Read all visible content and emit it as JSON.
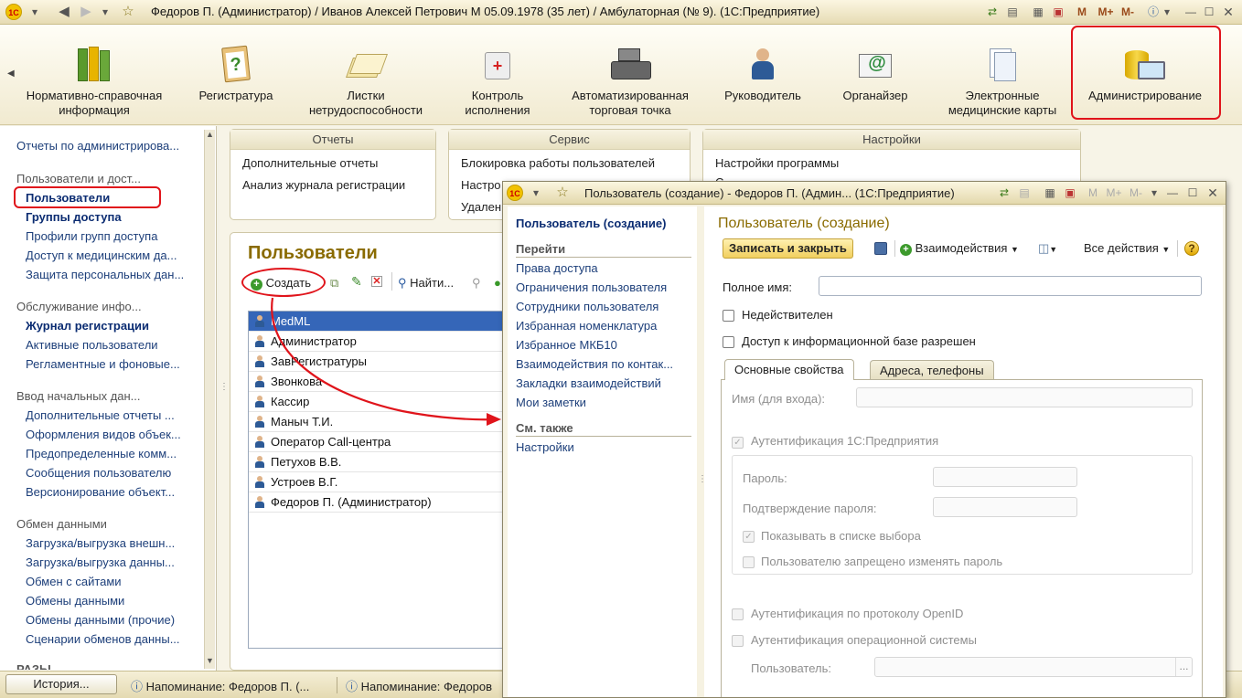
{
  "window": {
    "title": "Федоров П. (Администратор) / Иванов Алексей Петрович М 05.09.1978 (35 лет) / Амбулаторная (№ 9).  (1С:Предприятие)",
    "logo": "1С",
    "m_buttons": [
      "M",
      "M+",
      "M-"
    ]
  },
  "sections": [
    {
      "label": "Нормативно-справочная информация",
      "icon": "binders-icon"
    },
    {
      "label": "Регистратура",
      "icon": "clipboard-icon"
    },
    {
      "label": "Листки нетрудоспособности",
      "icon": "papers-icon"
    },
    {
      "label": "Контроль исполнения",
      "icon": "first-aid-icon"
    },
    {
      "label": "Автоматизированная торговая точка",
      "icon": "cash-register-icon"
    },
    {
      "label": "Руководитель",
      "icon": "manager-icon"
    },
    {
      "label": "Органайзер",
      "icon": "email-icon"
    },
    {
      "label": "Электронные медицинские карты",
      "icon": "documents-icon"
    },
    {
      "label": "Администрирование",
      "icon": "database-icon",
      "highlighted": true
    }
  ],
  "left_panel": {
    "top_item": "Отчеты по администрирова...",
    "group1": "Пользователи и дост...",
    "group1_items": [
      "Пользователи",
      "Группы доступа",
      "Профили групп доступа",
      "Доступ к медицинским да...",
      "Защита персональных дан..."
    ],
    "group2": "Обслуживание инфо...",
    "group2_items": [
      "Журнал регистрации",
      "Активные пользователи",
      "Регламентные и фоновые..."
    ],
    "group3": "Ввод начальных дан...",
    "group3_items": [
      "Дополнительные отчеты ...",
      "Оформления видов объек...",
      "Предопределенные комм...",
      "Сообщения пользователю",
      "Версионирование объект..."
    ],
    "group4": "Обмен данными",
    "group4_items": [
      "Загрузка/выгрузка внешн...",
      "Загрузка/выгрузка данны...",
      "Обмен с сайтами",
      "Обмены данными",
      "Обмены данными (прочие)",
      "Сценарии обменов данны..."
    ],
    "cut_group": "РАЗЫ..."
  },
  "groups": {
    "reports": {
      "title": "Отчеты",
      "links": [
        "Дополнительные отчеты",
        "Анализ журнала регистрации"
      ]
    },
    "service": {
      "title": "Сервис",
      "links": [
        "Блокировка работы пользователей",
        "Настро",
        "Удален"
      ]
    },
    "settings": {
      "title": "Настройки",
      "links": [
        "Настройки программы",
        "С"
      ]
    }
  },
  "users": {
    "title": "Пользователи",
    "toolbar": {
      "create": "Создать",
      "find": "Найти..."
    },
    "rows": [
      "MedML",
      "Администратор",
      "ЗавРегистратуры",
      "Звонкова",
      "Кассир",
      "Маныч Т.И.",
      "Оператор Call-центра",
      "Петухов В.В.",
      "Устроев В.Г.",
      "Федоров П. (Администратор)"
    ],
    "selected_index": 0
  },
  "bottom_bar": {
    "history": "История...",
    "tab1": "Напоминание: Федоров П. (...",
    "tab2": "Напоминание: Федоров"
  },
  "dialog": {
    "title": "Пользователь (создание) - Федоров П. (Админ...  (1С:Предприятие)",
    "nav": {
      "current": "Пользователь (создание)",
      "goto_head": "Перейти",
      "links": [
        "Права доступа",
        "Ограничения пользователя",
        "Сотрудники пользователя",
        "Избранная номенклатура",
        "Избранное МКБ10",
        "Взаимодействия по контак...",
        "Закладки взаимодействий",
        "Мои заметки"
      ],
      "see_also_head": "См. также",
      "see_also": [
        "Настройки"
      ]
    },
    "form": {
      "heading": "Пользователь (создание)",
      "save_close": "Записать и закрыть",
      "interactions": "Взаимодействия",
      "all_actions": "Все действия",
      "help": "?",
      "full_name_label": "Полное имя:",
      "full_name_value": "",
      "invalid_label": "Недействителен",
      "access_label": "Доступ к информационной базе разрешен",
      "tabs": [
        "Основные свойства",
        "Адреса, телефоны"
      ],
      "login_label": "Имя (для входа):",
      "auth1c_label": "Аутентификация 1С:Предприятия",
      "password_label": "Пароль:",
      "confirm_label": "Подтверждение пароля:",
      "show_in_list_label": "Показывать в списке выбора",
      "forbid_change_label": "Пользователю запрещено изменять пароль",
      "openid_label": "Аутентификация по протоколу OpenID",
      "os_auth_label": "Аутентификация операционной системы",
      "user_label": "Пользователь:",
      "browse": "..."
    }
  },
  "colors": {
    "highlight": "#e0141b",
    "link": "#1d3f7a",
    "accent": "#8a6b00"
  }
}
